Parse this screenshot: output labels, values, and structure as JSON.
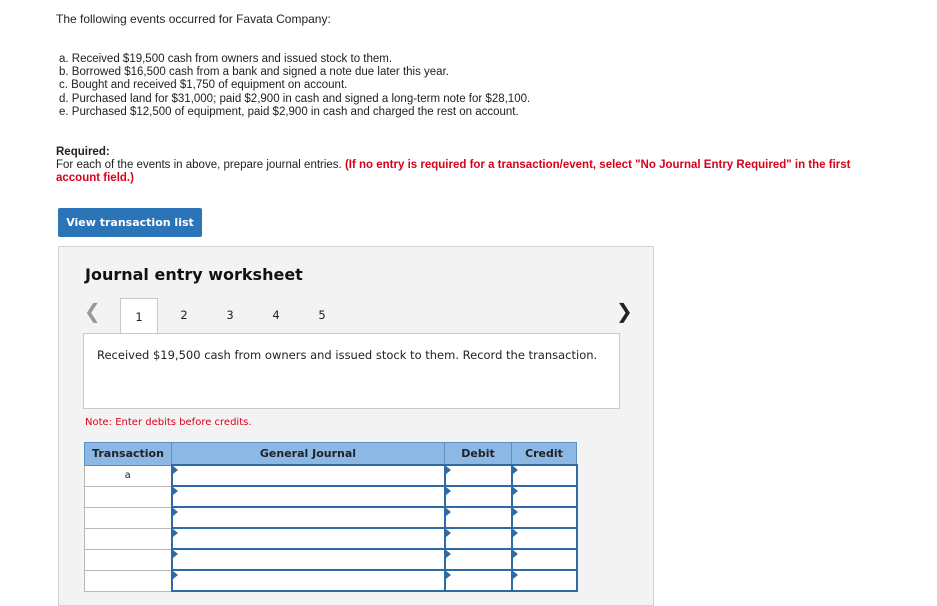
{
  "intro": "The following events occurred for Favata Company:",
  "events": [
    "a. Received $19,500 cash from owners and issued stock to them.",
    "b. Borrowed $16,500 cash from a bank and signed a note due later this year.",
    "c. Bought and received $1,750 of equipment on account.",
    "d. Purchased land for $31,000; paid $2,900 in cash and signed a long-term note for $28,100.",
    "e. Purchased $12,500 of equipment, paid $2,900 in cash and charged the rest on account."
  ],
  "required": {
    "head": "Required:",
    "text": "For each of the events in above, prepare journal entries.",
    "instruction": "(If no entry is required for a transaction/event, select \"No Journal Entry Required\" in the first account field.)"
  },
  "view_button": "View transaction list",
  "worksheet": {
    "title": "Journal entry worksheet",
    "tabs": [
      "1",
      "2",
      "3",
      "4",
      "5"
    ],
    "active_tab": 0,
    "description": "Received $19,500 cash from owners and issued stock to them. Record the transaction.",
    "note": "Note: Enter debits before credits.",
    "columns": [
      "Transaction",
      "General Journal",
      "Debit",
      "Credit"
    ],
    "rows": [
      {
        "transaction": "a",
        "account": "",
        "debit": "",
        "credit": ""
      },
      {
        "transaction": "",
        "account": "",
        "debit": "",
        "credit": ""
      },
      {
        "transaction": "",
        "account": "",
        "debit": "",
        "credit": ""
      },
      {
        "transaction": "",
        "account": "",
        "debit": "",
        "credit": ""
      },
      {
        "transaction": "",
        "account": "",
        "debit": "",
        "credit": ""
      },
      {
        "transaction": "",
        "account": "",
        "debit": "",
        "credit": ""
      }
    ]
  },
  "colors": {
    "accent": "#2b74b8",
    "header_bg": "#8cb8e6",
    "warning": "#d9001b"
  }
}
